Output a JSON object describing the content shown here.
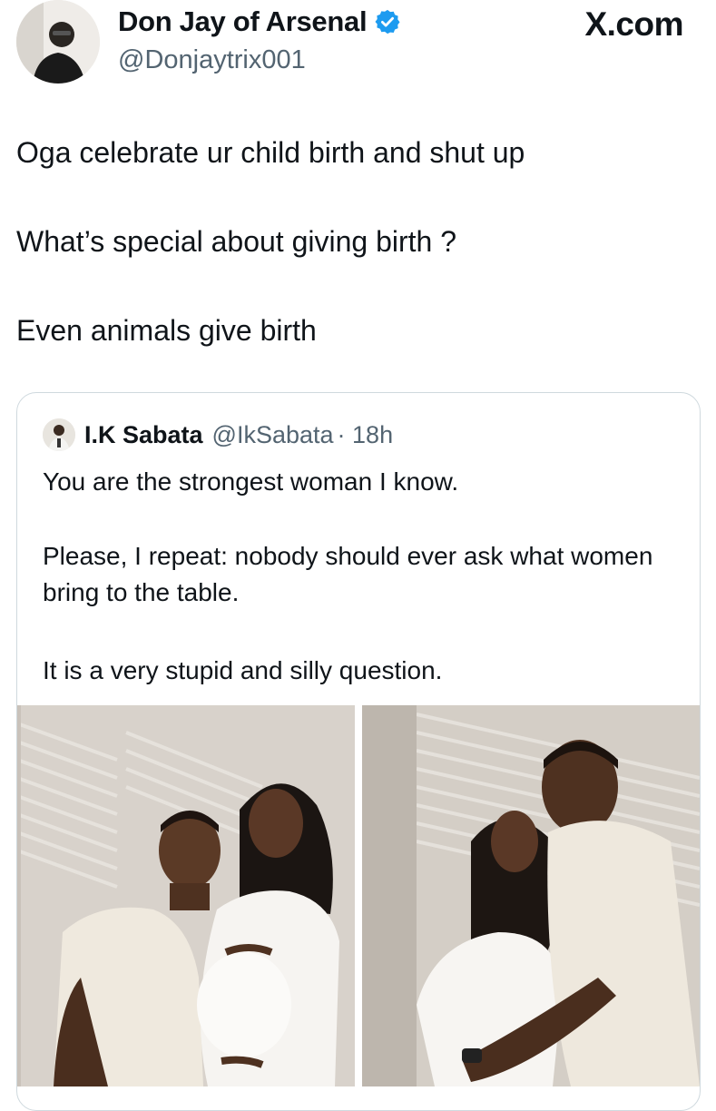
{
  "author": {
    "display_name": "Don Jay of Arsenal",
    "handle": "@Donjaytrix001",
    "avatar_icon": "user-avatar-photo",
    "verified_icon": "verified-badge-icon",
    "verified_color": "#1d9bf0"
  },
  "brand": {
    "label": "X.com"
  },
  "post": {
    "lines": [
      "Oga celebrate ur child birth and shut up",
      "What’s special about giving birth ?",
      "Even animals give birth"
    ]
  },
  "quoted": {
    "display_name": "I.K Sabata",
    "handle": "@IkSabata",
    "time": "· 18h",
    "paragraphs": [
      "You are the strongest woman I know.",
      "Please, I repeat: nobody should ever ask what women bring to the table.",
      "It is a very stupid and silly question."
    ],
    "media": [
      {
        "icon": "maternity-photo-couple-kneeling"
      },
      {
        "icon": "maternity-photo-couple-embrace"
      }
    ]
  },
  "colors": {
    "text": "#0f1419",
    "secondary": "#536471",
    "border": "#cfd9de"
  }
}
